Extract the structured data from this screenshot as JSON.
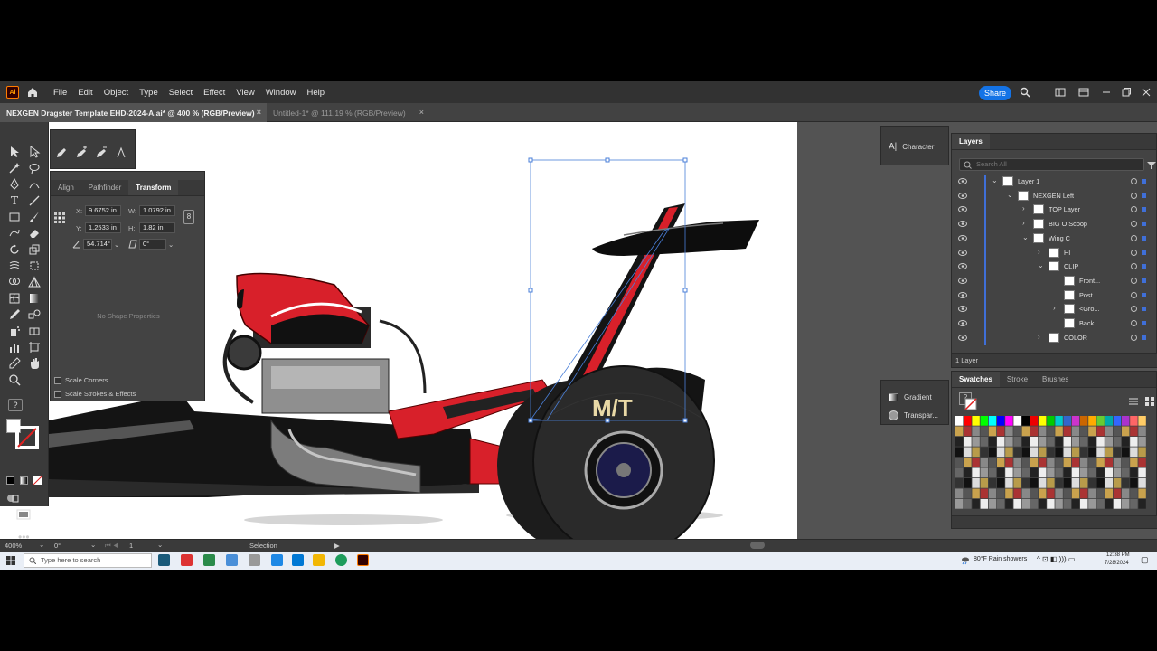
{
  "menubar": {
    "logo": "Ai",
    "items": [
      "File",
      "Edit",
      "Object",
      "Type",
      "Select",
      "Effect",
      "View",
      "Window",
      "Help"
    ],
    "share_label": "Share"
  },
  "tabs": [
    {
      "label": "NEXGEN Dragster Template EHD-2024-A.ai* @ 400 % (RGB/Preview)",
      "close": "×"
    },
    {
      "label": "Untitled-1* @ 111.19 % (RGB/Preview)",
      "close": "×"
    }
  ],
  "transform_panel": {
    "tabs": [
      "Align",
      "Pathfinder",
      "Transform"
    ],
    "x_label": "X:",
    "x_value": "9.6752 in",
    "y_label": "Y:",
    "y_value": "1.2533 in",
    "w_label": "W:",
    "w_value": "1.0792 in",
    "h_label": "H:",
    "h_value": "1.82 in",
    "angle_value": "54.714°",
    "shear_value": "0°",
    "no_shape": "No Shape Properties",
    "scale_corners": "Scale Corners",
    "scale_strokes": "Scale Strokes & Effects"
  },
  "dock": {
    "character": "Character",
    "gradient": "Gradient",
    "transparency": "Transpar..."
  },
  "layers_panel": {
    "tab": "Layers",
    "search_placeholder": "Search All",
    "rows": [
      {
        "name": "Layer 1",
        "indent": 0,
        "arrow": "v"
      },
      {
        "name": "NEXGEN Left",
        "indent": 1,
        "arrow": "v"
      },
      {
        "name": "TOP Layer",
        "indent": 2,
        "arrow": ">"
      },
      {
        "name": "BIG O Scoop",
        "indent": 2,
        "arrow": ">"
      },
      {
        "name": "Wing C",
        "indent": 2,
        "arrow": "v"
      },
      {
        "name": "HI",
        "indent": 3,
        "arrow": ">"
      },
      {
        "name": "CLIP",
        "indent": 3,
        "arrow": "v"
      },
      {
        "name": "Front...",
        "indent": 4,
        "arrow": ""
      },
      {
        "name": "Post",
        "indent": 4,
        "arrow": ""
      },
      {
        "name": "<Gro...",
        "indent": 4,
        "arrow": ">"
      },
      {
        "name": "Back ...",
        "indent": 4,
        "arrow": ""
      },
      {
        "name": "COLOR",
        "indent": 3,
        "arrow": ">"
      }
    ],
    "footer": "1 Layer"
  },
  "swatches_panel": {
    "tabs": [
      "Swatches",
      "Stroke",
      "Brushes"
    ]
  },
  "statusbar": {
    "zoom": "400%",
    "rotation": "0°",
    "artboard": "1",
    "tool": "Selection"
  },
  "taskbar": {
    "search_placeholder": "Type here to search",
    "weather": "80°F  Rain showers",
    "time": "12:38 PM",
    "date": "7/28/2024"
  },
  "colors": {
    "accent": "#1473e6",
    "layer_bar": "#3f6fd8",
    "car_red": "#d8202a",
    "car_black": "#1a1a1a"
  }
}
